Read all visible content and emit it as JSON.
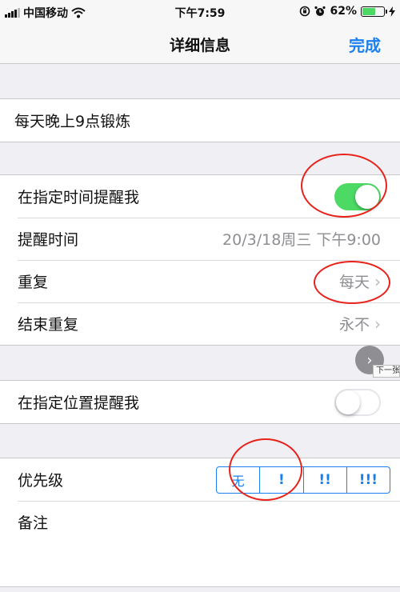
{
  "status_bar": {
    "carrier": "中国移动",
    "time": "下午7:59",
    "battery_percent": "62%",
    "battery_level": 0.62,
    "battery_color": "#4cd964"
  },
  "nav": {
    "title": "详细信息",
    "done_label": "完成",
    "accent_color": "#1a7ff0"
  },
  "reminder": {
    "title": "每天晚上9点锻炼"
  },
  "alarm_group": {
    "remind_at_time_label": "在指定时间提醒我",
    "remind_at_time_on": true,
    "alarm_time_label": "提醒时间",
    "alarm_time_value": "20/3/18周三 下午9:00",
    "repeat_label": "重复",
    "repeat_value": "每天",
    "end_repeat_label": "结束重复",
    "end_repeat_value": "永不"
  },
  "location_group": {
    "remind_at_location_label": "在指定位置提醒我",
    "remind_at_location_on": false
  },
  "overlay": {
    "next_tooltip": "下一张"
  },
  "priority_group": {
    "priority_label": "优先级",
    "options": [
      "无",
      "!",
      "!!",
      "!!!"
    ],
    "selected_index": 1,
    "notes_label": "备注"
  },
  "icons": {
    "signal": "signal-bars-icon",
    "wifi": "wifi-icon",
    "rotation_lock": "rotation-lock-icon",
    "alarm": "alarm-clock-icon",
    "charging": "charging-bolt-icon",
    "chevron": "chevron-right-icon"
  },
  "annotation_color": "#e8221b"
}
